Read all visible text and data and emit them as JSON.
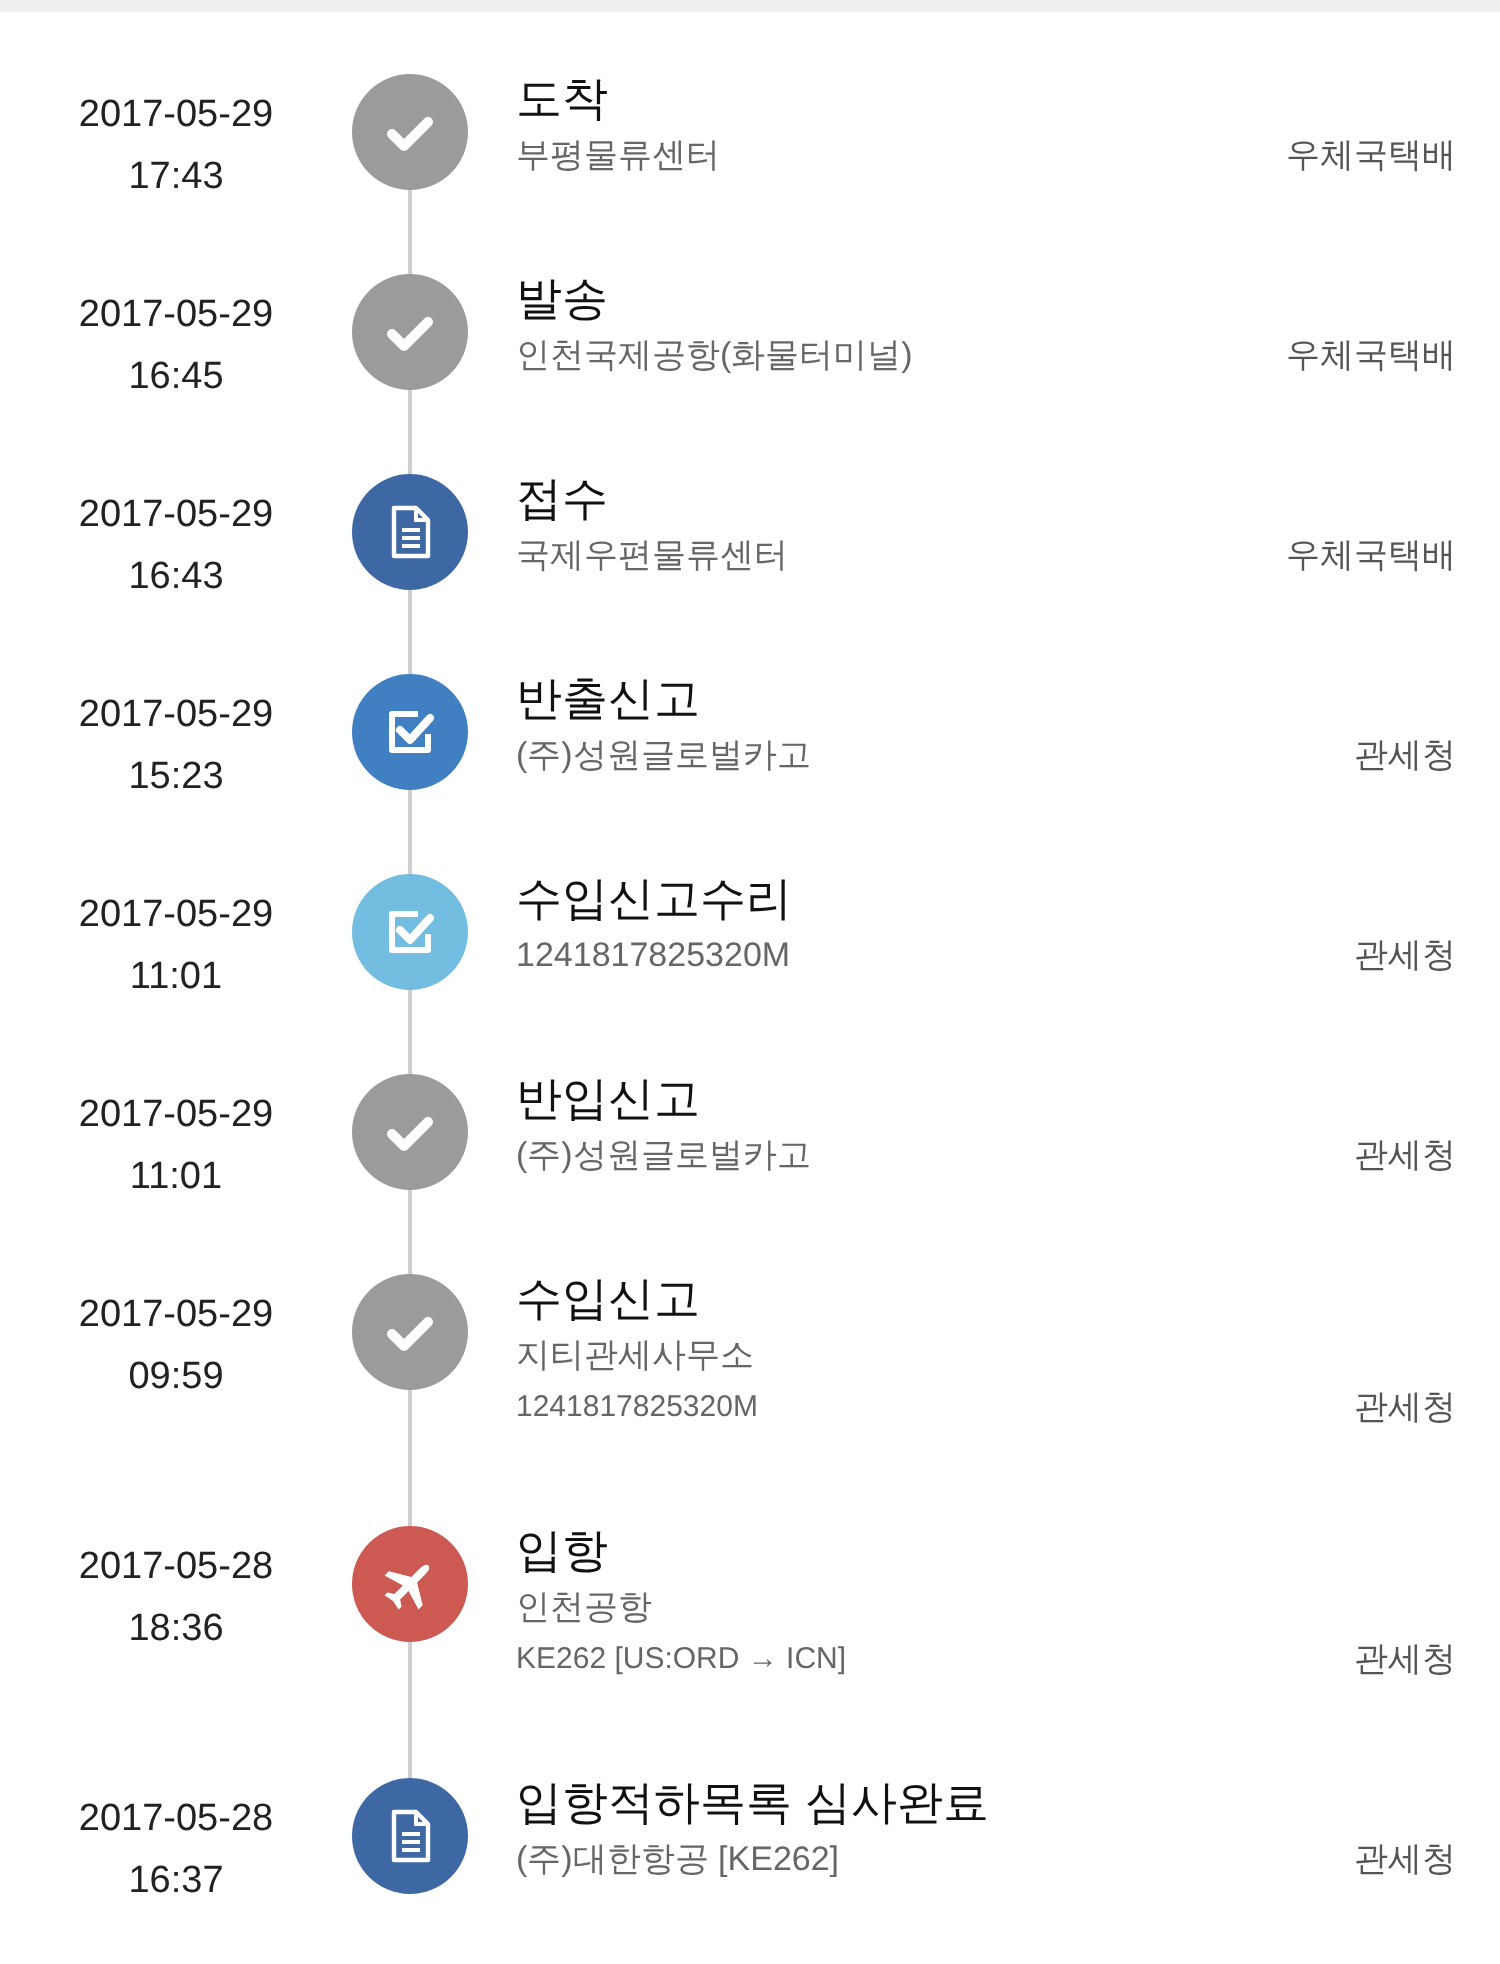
{
  "events": [
    {
      "date": "2017-05-29",
      "time": "17:43",
      "kind": "check",
      "color": "#9b9b9b",
      "title": "도착",
      "lines": [
        "부평물류센터"
      ],
      "agency": "우체국택배"
    },
    {
      "date": "2017-05-29",
      "time": "16:45",
      "kind": "check",
      "color": "#9b9b9b",
      "title": "발송",
      "lines": [
        "인천국제공항(화물터미널)"
      ],
      "agency": "우체국택배"
    },
    {
      "date": "2017-05-29",
      "time": "16:43",
      "kind": "document",
      "color": "#3d68a3",
      "title": "접수",
      "lines": [
        "국제우편물류센터"
      ],
      "agency": "우체국택배"
    },
    {
      "date": "2017-05-29",
      "time": "15:23",
      "kind": "checkbox",
      "color": "#407fc2",
      "title": "반출신고",
      "lines": [
        "(주)성원글로벌카고"
      ],
      "agency": "관세청"
    },
    {
      "date": "2017-05-29",
      "time": "11:01",
      "kind": "checkbox",
      "color": "#73bde0",
      "title": "수입신고수리",
      "lines": [
        "1241817825320M"
      ],
      "agency": "관세청"
    },
    {
      "date": "2017-05-29",
      "time": "11:01",
      "kind": "check",
      "color": "#9b9b9b",
      "title": "반입신고",
      "lines": [
        "(주)성원글로벌카고"
      ],
      "agency": "관세청"
    },
    {
      "date": "2017-05-29",
      "time": "09:59",
      "kind": "check",
      "color": "#9b9b9b",
      "title": "수입신고",
      "lines": [
        "지티관세사무소",
        "1241817825320M"
      ],
      "agency": "관세청"
    },
    {
      "date": "2017-05-28",
      "time": "18:36",
      "kind": "plane",
      "color": "#cd5a52",
      "title": "입항",
      "lines": [
        "인천공항",
        "KE262 [US:ORD → ICN]"
      ],
      "agency": "관세청"
    },
    {
      "date": "2017-05-28",
      "time": "16:37",
      "kind": "document",
      "color": "#3d68a3",
      "title": "입항적하목록 심사완료",
      "lines": [
        "(주)대한항공 [KE262]"
      ],
      "agency": "관세청"
    }
  ]
}
